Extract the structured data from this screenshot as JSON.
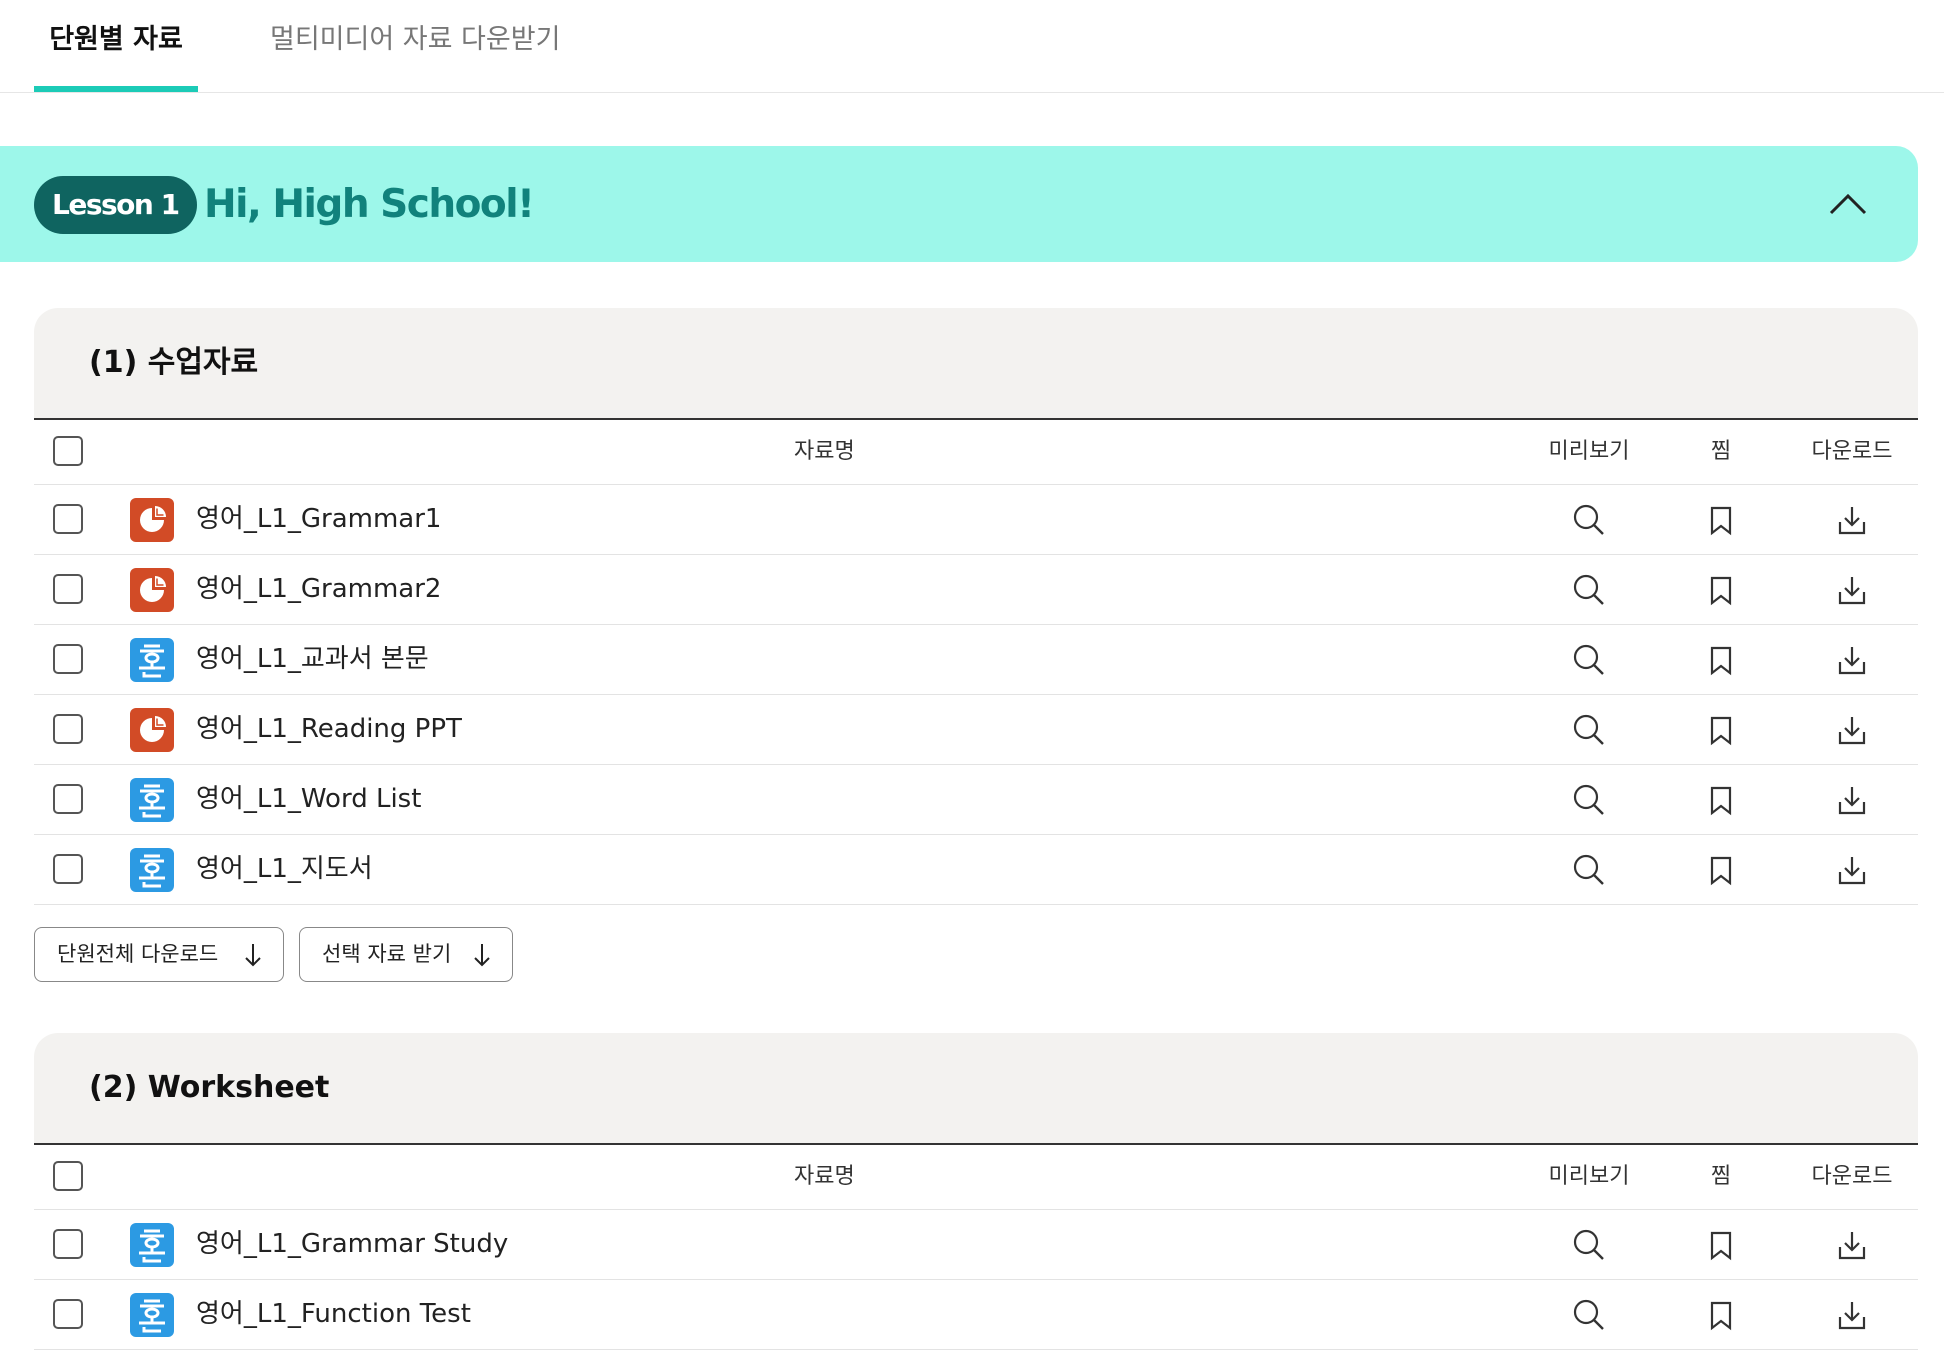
{
  "tabs": [
    {
      "label": "단원별 자료",
      "active": true
    },
    {
      "label": "멀티미디어 자료 다운받기",
      "active": false
    }
  ],
  "lesson": {
    "badge": "Lesson 1",
    "title": "Hi, High School!"
  },
  "columns": {
    "name": "자료명",
    "preview": "미리보기",
    "favorite": "찜",
    "download": "다운로드"
  },
  "sections": [
    {
      "title": "(1) 수업자료",
      "files": [
        {
          "name": "영어_L1_Grammar1",
          "type": "ppt"
        },
        {
          "name": "영어_L1_Grammar2",
          "type": "ppt"
        },
        {
          "name": "영어_L1_교과서 본문",
          "type": "hwp"
        },
        {
          "name": "영어_L1_Reading PPT",
          "type": "ppt"
        },
        {
          "name": "영어_L1_Word List",
          "type": "hwp"
        },
        {
          "name": "영어_L1_지도서",
          "type": "hwp"
        }
      ],
      "buttons": {
        "download_all": "단원전체 다운로드",
        "download_selected": "선택 자료 받기"
      }
    },
    {
      "title": "(2) Worksheet",
      "files": [
        {
          "name": "영어_L1_Grammar Study",
          "type": "hwp"
        },
        {
          "name": "영어_L1_Function Test",
          "type": "hwp"
        }
      ]
    }
  ],
  "colors": {
    "accent": "#1ccbb7",
    "lesson_bg": "#9df7ea",
    "badge_bg": "#0f6460",
    "title_color": "#11827c",
    "ppt_icon": "#d24b26",
    "hwp_icon": "#2c9ae3"
  }
}
